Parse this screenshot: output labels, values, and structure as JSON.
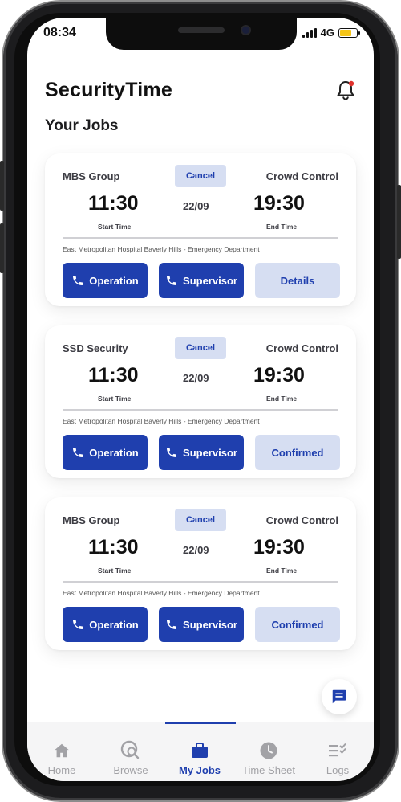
{
  "status_bar": {
    "time": "08:34",
    "network": "4G"
  },
  "header": {
    "title": "SecurityTime"
  },
  "section_title": "Your Jobs",
  "colors": {
    "primary": "#1f3fae",
    "primary_light": "#d6def2",
    "battery": "#f5c518",
    "notification_dot": "#e0322d"
  },
  "jobs": [
    {
      "company": "MBS Group",
      "cancel_label": "Cancel",
      "job_type": "Crowd Control",
      "start_time": "11:30",
      "date": "22/09",
      "end_time": "19:30",
      "start_label": "Start Time",
      "end_label": "End Time",
      "location": "East Metropolitan Hospital Baverly Hills - Emergency Department",
      "operation_label": "Operation",
      "supervisor_label": "Supervisor",
      "action_label": "Details"
    },
    {
      "company": "SSD Security",
      "cancel_label": "Cancel",
      "job_type": "Crowd Control",
      "start_time": "11:30",
      "date": "22/09",
      "end_time": "19:30",
      "start_label": "Start Time",
      "end_label": "End Time",
      "location": "East Metropolitan Hospital Baverly Hills - Emergency Department",
      "operation_label": "Operation",
      "supervisor_label": "Supervisor",
      "action_label": "Confirmed"
    },
    {
      "company": "MBS Group",
      "cancel_label": "Cancel",
      "job_type": "Crowd Control",
      "start_time": "11:30",
      "date": "22/09",
      "end_time": "19:30",
      "start_label": "Start Time",
      "end_label": "End Time",
      "location": "East Metropolitan Hospital Baverly Hills - Emergency Department",
      "operation_label": "Operation",
      "supervisor_label": "Supervisor",
      "action_label": "Confirmed"
    }
  ],
  "tabbar": {
    "items": [
      {
        "label": "Home",
        "icon": "home-icon"
      },
      {
        "label": "Browse",
        "icon": "browse-icon"
      },
      {
        "label": "My Jobs",
        "icon": "briefcase-icon",
        "active": true
      },
      {
        "label": "Time Sheet",
        "icon": "clock-icon"
      },
      {
        "label": "Logs",
        "icon": "logs-icon"
      }
    ]
  },
  "fab": {
    "icon": "chat-icon"
  }
}
